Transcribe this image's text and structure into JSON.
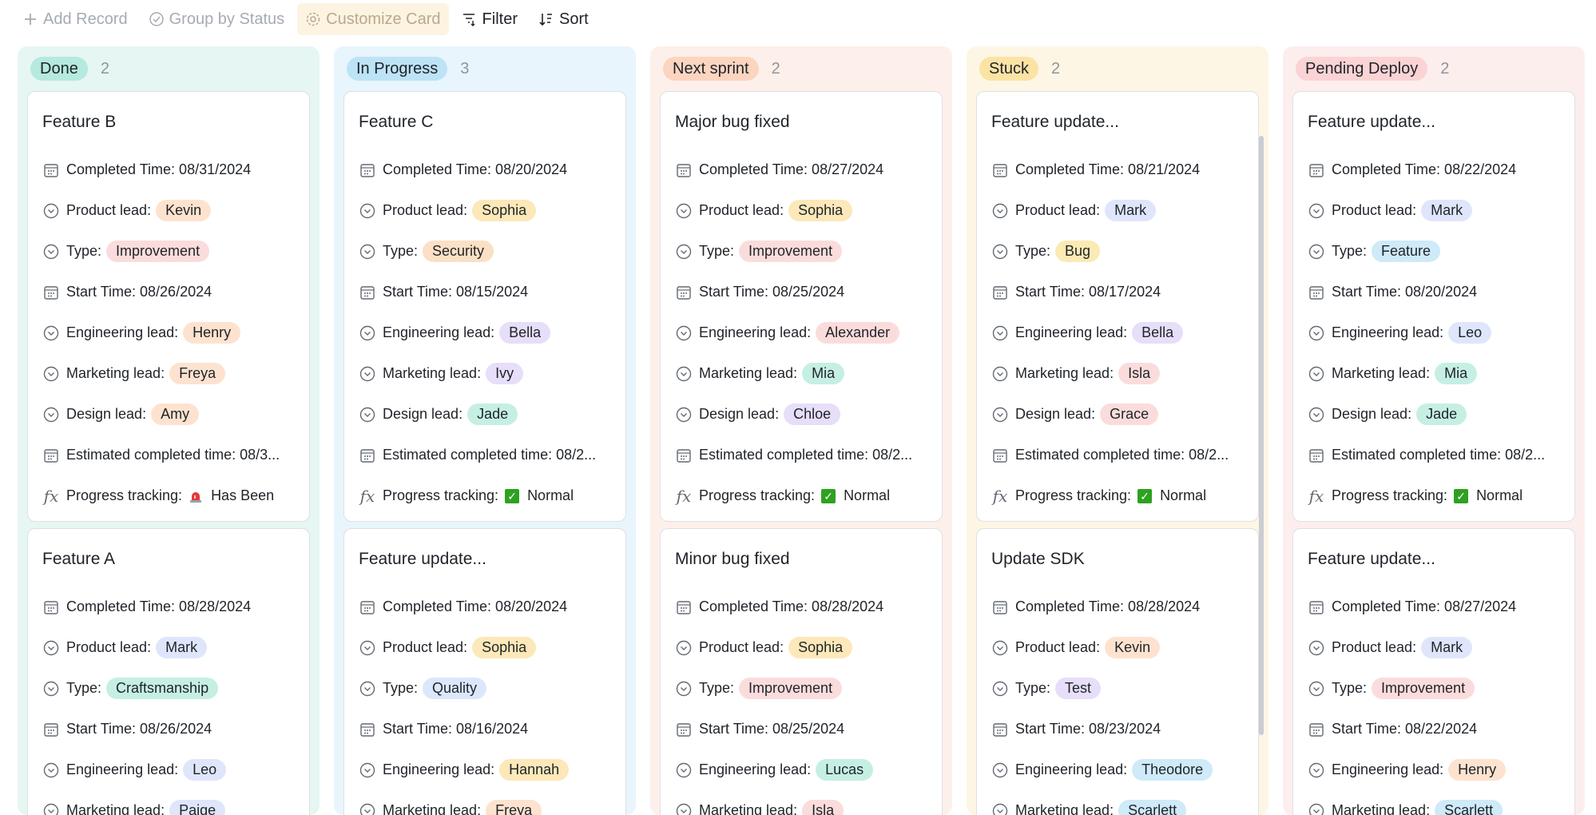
{
  "toolbar": {
    "add_record": "Add Record",
    "group_by": "Group by Status",
    "customize_card": "Customize Card",
    "filter": "Filter",
    "sort": "Sort"
  },
  "colors": {
    "done_bg": "#e6f6f3",
    "done_pill": "#b5eadf",
    "inprogress_bg": "#e8f5fc",
    "inprogress_pill": "#bde3f7",
    "nextsprint_bg": "#fdf0ea",
    "nextsprint_pill": "#fbd5bf",
    "stuck_bg": "#fdf6e5",
    "stuck_pill": "#fbe3a4",
    "pending_bg": "#fdeeee",
    "pending_pill": "#fad3d5"
  },
  "columns": [
    {
      "status": "Done",
      "count": "2",
      "cards": [
        {
          "title": "Feature B",
          "completed_time": "Completed Time: 08/31/2024",
          "product_lead": "Kevin",
          "type": "Improvement",
          "start_time": "Start Time: 08/26/2024",
          "engineering_lead": "Henry",
          "marketing_lead": "Freya",
          "design_lead": "Amy",
          "estimated": "Estimated completed time: 08/3...",
          "progress": "Has Been"
        },
        {
          "title": "Feature A",
          "completed_time": "Completed Time: 08/28/2024",
          "product_lead": "Mark",
          "type": "Craftsmanship",
          "start_time": "Start Time: 08/26/2024",
          "engineering_lead": "Leo",
          "marketing_lead": "Paige"
        }
      ]
    },
    {
      "status": "In Progress",
      "count": "3",
      "cards": [
        {
          "title": "Feature C",
          "completed_time": "Completed Time: 08/20/2024",
          "product_lead": "Sophia",
          "type": "Security",
          "start_time": "Start Time: 08/15/2024",
          "engineering_lead": "Bella",
          "marketing_lead": "Ivy",
          "design_lead": "Jade",
          "estimated": "Estimated completed time: 08/2...",
          "progress": "Normal"
        },
        {
          "title": "Feature update...",
          "completed_time": "Completed Time: 08/20/2024",
          "product_lead": "Sophia",
          "type": "Quality",
          "start_time": "Start Time: 08/16/2024",
          "engineering_lead": "Hannah",
          "marketing_lead": "Freya"
        }
      ]
    },
    {
      "status": "Next sprint",
      "count": "2",
      "cards": [
        {
          "title": "Major bug fixed",
          "completed_time": "Completed Time: 08/27/2024",
          "product_lead": "Sophia",
          "type": "Improvement",
          "start_time": "Start Time: 08/25/2024",
          "engineering_lead": "Alexander",
          "marketing_lead": "Mia",
          "design_lead": "Chloe",
          "estimated": "Estimated completed time: 08/2...",
          "progress": "Normal"
        },
        {
          "title": "Minor bug fixed",
          "completed_time": "Completed Time: 08/28/2024",
          "product_lead": "Sophia",
          "type": "Improvement",
          "start_time": "Start Time: 08/25/2024",
          "engineering_lead": "Lucas",
          "marketing_lead": "Isla"
        }
      ]
    },
    {
      "status": "Stuck",
      "count": "2",
      "cards": [
        {
          "title": "Feature update...",
          "completed_time": "Completed Time: 08/21/2024",
          "product_lead": "Mark",
          "type": "Bug",
          "start_time": "Start Time: 08/17/2024",
          "engineering_lead": "Bella",
          "marketing_lead": "Isla",
          "design_lead": "Grace",
          "estimated": "Estimated completed time: 08/2...",
          "progress": "Normal"
        },
        {
          "title": "Update SDK",
          "completed_time": "Completed Time: 08/28/2024",
          "product_lead": "Kevin",
          "type": "Test",
          "start_time": "Start Time: 08/23/2024",
          "engineering_lead": "Theodore",
          "marketing_lead": "Scarlett"
        }
      ]
    },
    {
      "status": "Pending Deploy",
      "count": "2",
      "cards": [
        {
          "title": "Feature update...",
          "completed_time": "Completed Time: 08/22/2024",
          "product_lead": "Mark",
          "type": "Feature",
          "start_time": "Start Time: 08/20/2024",
          "engineering_lead": "Leo",
          "marketing_lead": "Mia",
          "design_lead": "Jade",
          "estimated": "Estimated completed time: 08/2...",
          "progress": "Normal"
        },
        {
          "title": "Feature update...",
          "completed_time": "Completed Time: 08/27/2024",
          "product_lead": "Mark",
          "type": "Improvement",
          "start_time": "Start Time: 08/22/2024",
          "engineering_lead": "Henry",
          "marketing_lead": "Scarlett"
        }
      ]
    }
  ],
  "labels": {
    "product_lead": "Product lead:",
    "type": "Type:",
    "engineering_lead": "Engineering lead:",
    "marketing_lead": "Marketing lead:",
    "design_lead": "Design lead:",
    "progress_tracking": "Progress tracking:",
    "fx": "fx"
  },
  "tag_colors": {
    "Kevin": "#fde3cf",
    "Mark": "#dfe6fb",
    "Sophia": "#fce8b8",
    "Improvement": "#fbdcdc",
    "Craftsmanship": "#c6efe4",
    "Security": "#fbe0c5",
    "Quality": "#dbe8fb",
    "Bug": "#fbeab4",
    "Test": "#e7def9",
    "Feature": "#cfeaf8",
    "Henry": "#fde3cf",
    "Leo": "#dfe6fb",
    "Bella": "#e7def9",
    "Hannah": "#fce8b8",
    "Alexander": "#fbdcdc",
    "Lucas": "#c6efe4",
    "Theodore": "#cfeaf8",
    "Freya": "#fde3cf",
    "Paige": "#dfe6fb",
    "Ivy": "#e7def9",
    "Mia": "#c6efe4",
    "Isla": "#fbdcdc",
    "Scarlett": "#cfeaf8",
    "Amy": "#fde3cf",
    "Jade": "#c6efe4",
    "Chloe": "#e7def9",
    "Grace": "#fbdcdc"
  }
}
